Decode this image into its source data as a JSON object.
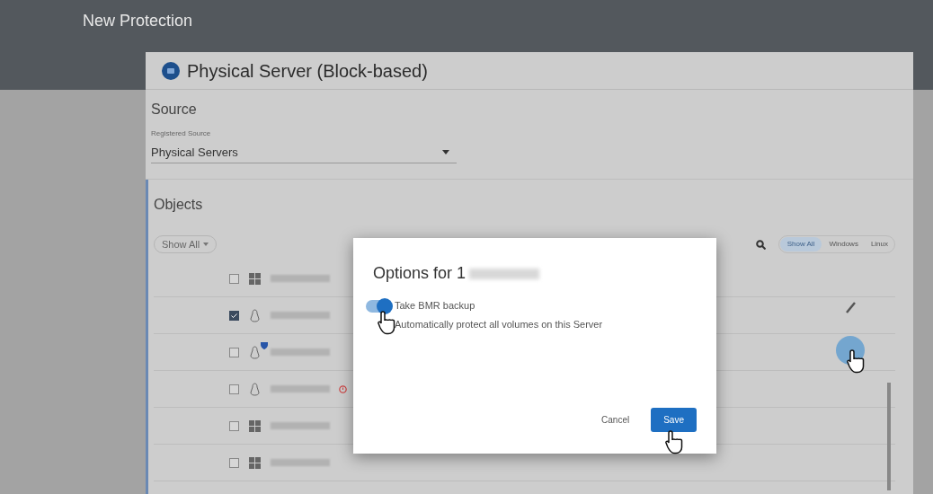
{
  "header": {
    "title": "New Protection"
  },
  "card": {
    "title": "Physical Server (Block-based)",
    "source": {
      "heading": "Source",
      "label": "Registered Source",
      "value": "Physical Servers"
    },
    "objects": {
      "heading": "Objects",
      "filter": "Show All",
      "os_tabs": [
        {
          "label": "Show All",
          "selected": true
        },
        {
          "label": "Windows",
          "selected": false
        },
        {
          "label": "Linux",
          "selected": false
        }
      ],
      "rows": [
        {
          "kind": "windows",
          "checked": false,
          "protected": false,
          "error": false
        },
        {
          "kind": "linux",
          "checked": true,
          "protected": false,
          "error": false
        },
        {
          "kind": "linux",
          "checked": false,
          "protected": true,
          "error": false
        },
        {
          "kind": "linux",
          "checked": false,
          "protected": false,
          "error": true
        },
        {
          "kind": "windows",
          "checked": false,
          "protected": false,
          "error": false
        },
        {
          "kind": "windows",
          "checked": false,
          "protected": false,
          "error": false
        }
      ]
    }
  },
  "dialog": {
    "title": "Options for 1",
    "toggle": {
      "on": true,
      "label": "Take BMR backup",
      "description": "Automatically protect all volumes on this Server"
    },
    "buttons": [
      {
        "kind": "text",
        "label": "Cancel"
      },
      {
        "kind": "primary",
        "label": "Save"
      }
    ]
  }
}
